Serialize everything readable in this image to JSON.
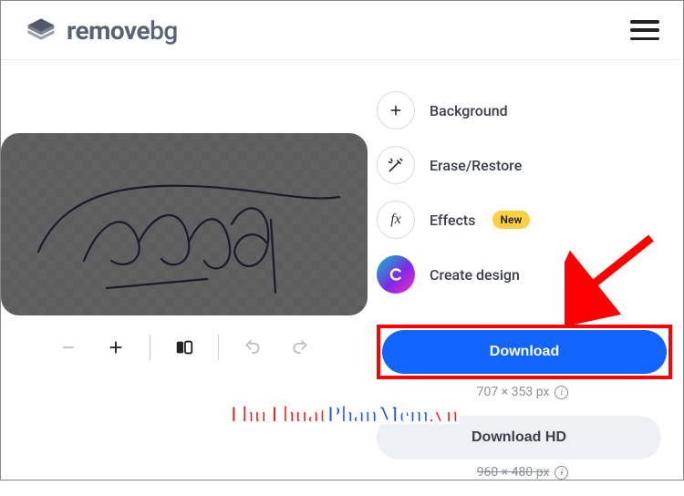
{
  "brand": {
    "name_bold": "remove",
    "name_light": "bg"
  },
  "options": {
    "background": "Background",
    "erase": "Erase/Restore",
    "effects": "Effects",
    "effects_badge": "New",
    "create": "Create design"
  },
  "download": {
    "primary": "Download",
    "primary_res": "707 × 353 px",
    "hd": "Download HD",
    "hd_res": "960 × 480 px"
  },
  "watermark": {
    "a": "ThuThuat",
    "b": "PhanMem",
    "c": ".vn"
  },
  "colors": {
    "accent": "#1164ff",
    "highlight": "#ff0000",
    "badge": "#ffcf3f"
  }
}
